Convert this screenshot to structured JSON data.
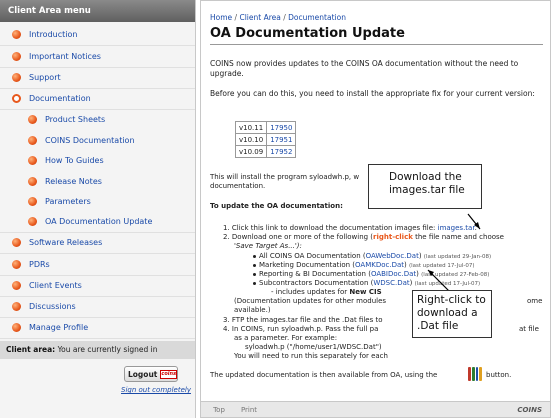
{
  "sidebar": {
    "header": "Client Area menu",
    "items": [
      {
        "label": "Introduction",
        "level": 0
      },
      {
        "label": "Important Notices",
        "level": 0
      },
      {
        "label": "Support",
        "level": 0
      },
      {
        "label": "Documentation",
        "level": 0,
        "open": true
      },
      {
        "label": "Product Sheets",
        "level": 1
      },
      {
        "label": "COINS Documentation",
        "level": 1
      },
      {
        "label": "How To Guides",
        "level": 1
      },
      {
        "label": "Release Notes",
        "level": 1
      },
      {
        "label": "Parameters",
        "level": 1
      },
      {
        "label": "OA Documentation Update",
        "level": 1
      },
      {
        "label": "Software Releases",
        "level": 0
      },
      {
        "label": "PDRs",
        "level": 0
      },
      {
        "label": "Client Events",
        "level": 0
      },
      {
        "label": "Discussions",
        "level": 0
      },
      {
        "label": "Manage Profile",
        "level": 0
      }
    ],
    "status_label": "Client area:",
    "status_text": "You are currently signed in",
    "logout_label": "Logout",
    "logout_logo": "coins",
    "signout_link": "Sign out completely"
  },
  "breadcrumb": {
    "home": "Home",
    "sep": "/",
    "client_area": "Client Area",
    "documentation": "Documentation"
  },
  "page_title": "OA Documentation Update",
  "content": {
    "intro": "COINS now provides updates to the COINS OA documentation without the need to upgrade.",
    "before": "Before you can do this, you need to install the appropriate fix for your current version:",
    "versions": [
      {
        "version": "v10.11",
        "fix": "17950"
      },
      {
        "version": "v10.10",
        "fix": "17951"
      },
      {
        "version": "v10.09",
        "fix": "17952"
      }
    ],
    "install_line1": "This will install the program syloadwh.p, w",
    "install_line2": "documentation.",
    "to_update": "To update the OA documentation:",
    "step1_prefix": "1.  Click this link to download the documentation images file:",
    "step1_link": "images.tar",
    "step1_end": ".",
    "step2_a": "2.  Download one or more of the following (",
    "step2_rc": "right-click",
    "step2_b": " the file name and choose",
    "step2_c": "'Save Target As...'):",
    "docs": [
      {
        "label": "All COINS OA Documentation (",
        "file": "OAWebDoc.Dat",
        "note": "(last updated 29-Jan-08)"
      },
      {
        "label": "Marketing Documentation (",
        "file": "OAMKDoc.Dat",
        "note": "(last updated 17-Jul-07)"
      },
      {
        "label": "Reporting & BI Documentation (",
        "file": "OABIDoc.Dat",
        "note": "(last updated 27-Feb-08)"
      },
      {
        "label": "Subcontractors Documentation (",
        "file": "WDSC.Dat",
        "note": "(last updated 17-Jul-07)"
      }
    ],
    "cis_a": "- includes updates for ",
    "cis_b": "New CIS",
    "docs_note1": "(Documentation updates for other modules",
    "docs_note2": "available.)",
    "docs_note_end": "ome",
    "step3_a": "3.  FTP the images.tar file and the .Dat files to",
    "step4_a": "4.  In COINS, run syloadwh.p.  Pass the full pa",
    "step4_end": "at file",
    "step4_b": "as a parameter.  For example:",
    "step4_c": "syloadwh.p (\"/home/user1/WDSC.Dat\")",
    "step4_d": "You will need to run this separately for each",
    "outro_a": "The updated documentation is then available from OA, using the",
    "outro_b": "button."
  },
  "footer": {
    "top": "Top",
    "print": "Print",
    "brand": "COINS"
  },
  "callouts": {
    "download": "Download the images.tar file",
    "rightclick": "Right-click to download a .Dat file"
  }
}
